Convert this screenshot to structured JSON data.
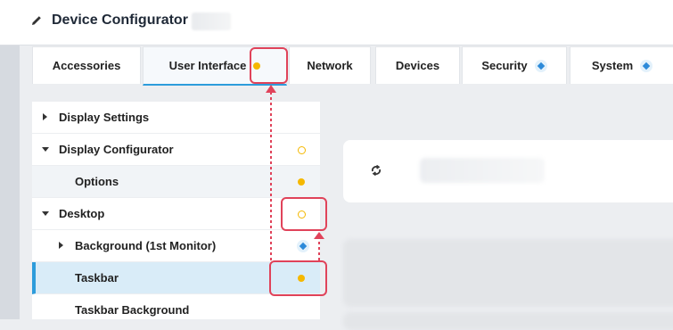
{
  "app": {
    "title": "Device Configurator"
  },
  "tabs": [
    {
      "label": "Accessories",
      "indicator": "none"
    },
    {
      "label": "User Interface",
      "indicator": "changed",
      "active": true
    },
    {
      "label": "Network",
      "indicator": "none"
    },
    {
      "label": "Devices",
      "indicator": "none"
    },
    {
      "label": "Security",
      "indicator": "info"
    },
    {
      "label": "System",
      "indicator": "info"
    }
  ],
  "tree": [
    {
      "label": "Display Settings",
      "caret": "collapsed",
      "status": "none"
    },
    {
      "label": "Display Configurator",
      "caret": "expanded",
      "status": "pending"
    },
    {
      "label": "Options",
      "caret": "none",
      "status": "changed"
    },
    {
      "label": "Desktop",
      "caret": "expanded",
      "status": "pending"
    },
    {
      "label": "Background (1st Monitor)",
      "caret": "collapsed",
      "status": "info"
    },
    {
      "label": "Taskbar",
      "caret": "none",
      "status": "changed",
      "selected": true
    },
    {
      "label": "Taskbar Background",
      "caret": "none",
      "status": "none"
    }
  ],
  "colors": {
    "accent": "#2d9cdb",
    "changed": "#f5b800",
    "info": "#2d8ad9",
    "highlight": "#e0435a"
  },
  "icons": [
    "pencil-icon",
    "refresh-icon",
    "caret-right-icon",
    "caret-down-icon",
    "status-dot-icon",
    "diamond-icon"
  ]
}
